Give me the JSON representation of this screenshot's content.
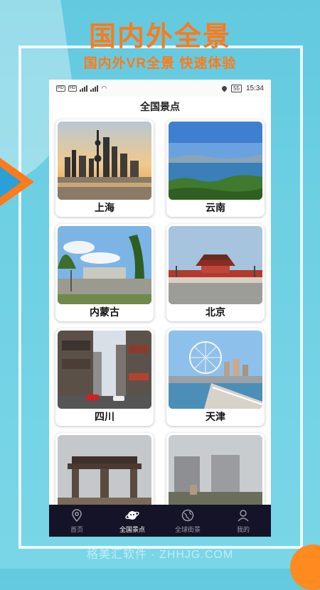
{
  "banner": {
    "headline": "国内外全景",
    "subheadline": "国内外VR全景  快速体验",
    "watermark": "格美汇软件 · ZHHJG.COM"
  },
  "statusbar": {
    "left_chips": [
      "HD",
      "HD"
    ],
    "signal": "4G",
    "battery": "55",
    "time": "15:34"
  },
  "page_title": "全国景点",
  "spots": [
    {
      "name": "上海",
      "photo": "shanghai-skyline"
    },
    {
      "name": "云南",
      "photo": "yunnan-lake"
    },
    {
      "name": "内蒙古",
      "photo": "inner-mongolia-park"
    },
    {
      "name": "北京",
      "photo": "beijing-tiananmen"
    },
    {
      "name": "四川",
      "photo": "sichuan-street"
    },
    {
      "name": "天津",
      "photo": "tianjin-eye"
    },
    {
      "name": "",
      "photo": "stone-gate"
    },
    {
      "name": "",
      "photo": "city-towers"
    }
  ],
  "tabs": [
    {
      "label": "首页",
      "icon": "location-pin-icon",
      "active": false
    },
    {
      "label": "全国景点",
      "icon": "planet-icon",
      "active": true
    },
    {
      "label": "全球街景",
      "icon": "globe-icon",
      "active": false
    },
    {
      "label": "我的",
      "icon": "user-icon",
      "active": false
    }
  ],
  "colors": {
    "accent": "#ff7a1a",
    "background": "#6fd0e3",
    "tabbar": "#141327"
  }
}
